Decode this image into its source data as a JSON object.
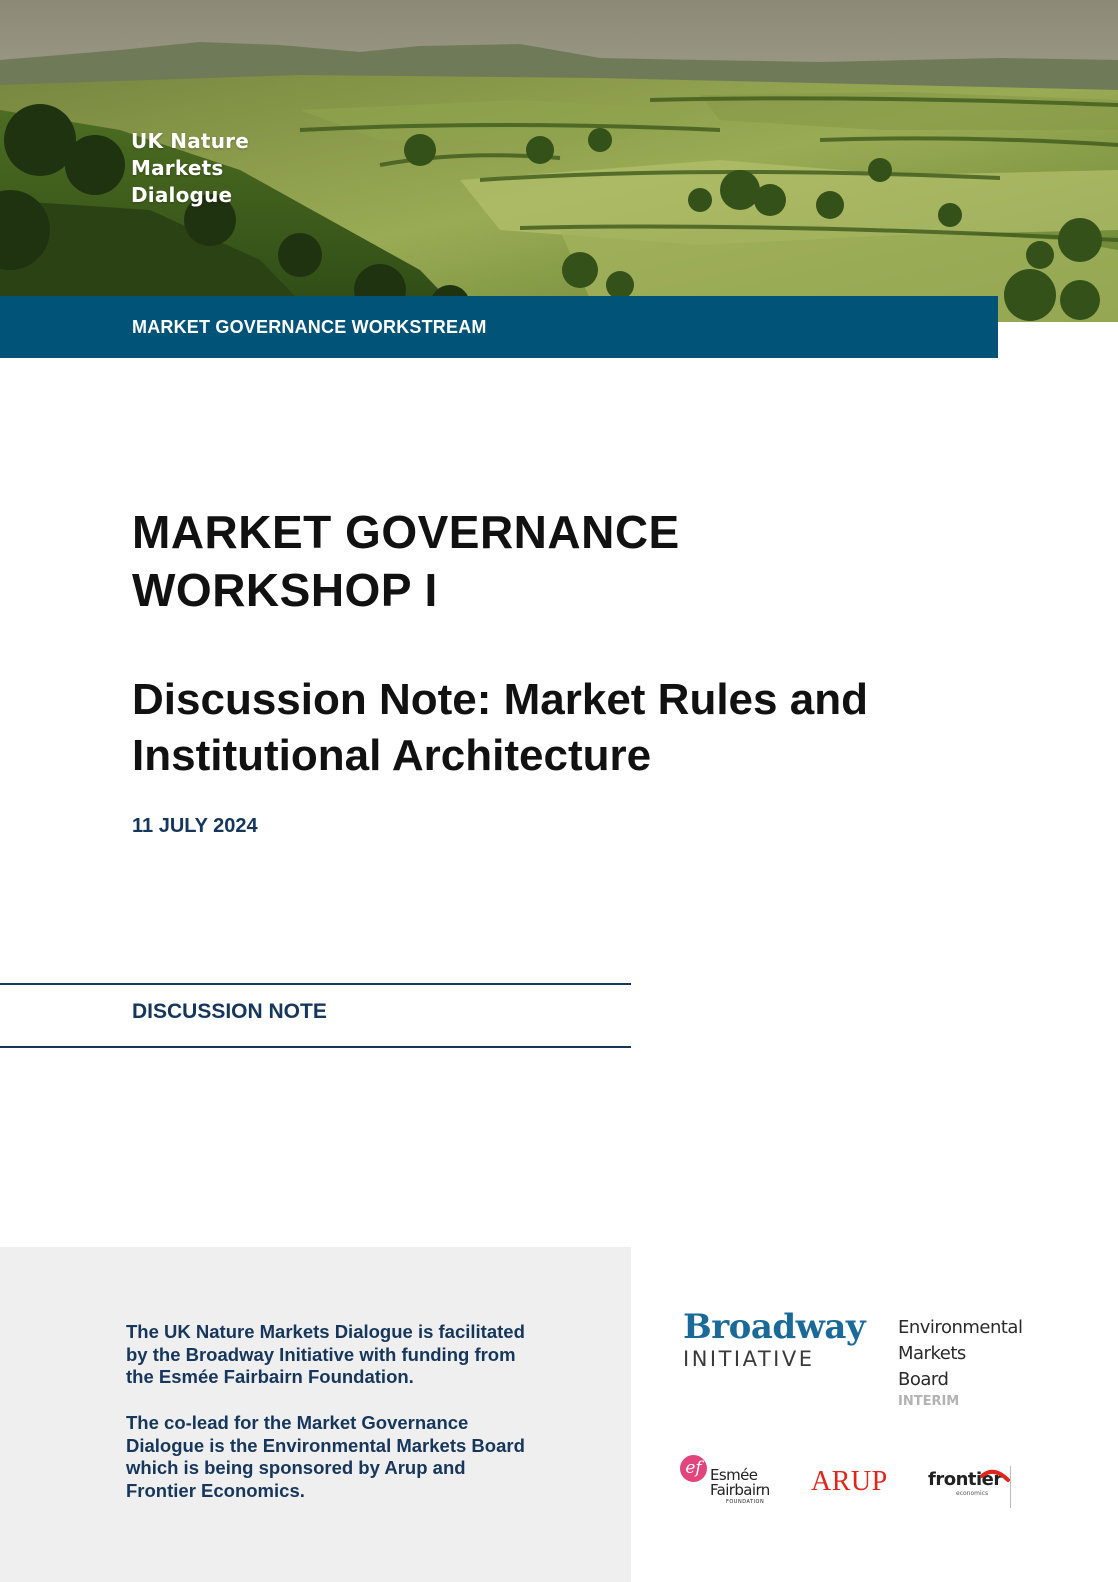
{
  "hero": {
    "brand_lines": [
      "UK Nature",
      "Markets",
      "Dialogue"
    ]
  },
  "workstream": "MARKET GOVERNANCE WORKSTREAM",
  "title_lines": [
    "MARKET GOVERNANCE",
    "WORKSHOP I"
  ],
  "subtitle_lines": [
    "Discussion Note: Market Rules and",
    "Institutional Architecture"
  ],
  "date": "11 JULY 2024",
  "document_type": "DISCUSSION NOTE",
  "footer": {
    "paragraph1_lines": [
      "The UK Nature Markets Dialogue is facilitated",
      "by the Broadway Initiative with funding from",
      "the Esmée Fairbairn Foundation."
    ],
    "paragraph2_lines": [
      "The co-lead for the Market Governance",
      "Dialogue is the Environmental Markets Board",
      "which is being sponsored by Arup and",
      "Frontier Economics."
    ]
  },
  "logos": {
    "broadway": {
      "word": "Broadway",
      "sub": "INITIATIVE"
    },
    "emb": {
      "lines": [
        "Environmental",
        "Markets",
        "Board"
      ],
      "status": "INTERIM"
    },
    "esmee": {
      "mark": "ef",
      "lines": [
        "Esmée",
        "Fairbairn"
      ],
      "sub": "FOUNDATION"
    },
    "arup": "ARUP",
    "frontier": {
      "word": "frontier",
      "sub": "economics"
    }
  },
  "colors": {
    "brand_blue": "#015378",
    "navy_text": "#16365c",
    "footer_panel": "#efefef",
    "broadway_blue": "#1a6a99",
    "esmee_pink": "#e2457c",
    "arup_red": "#e1251b"
  }
}
